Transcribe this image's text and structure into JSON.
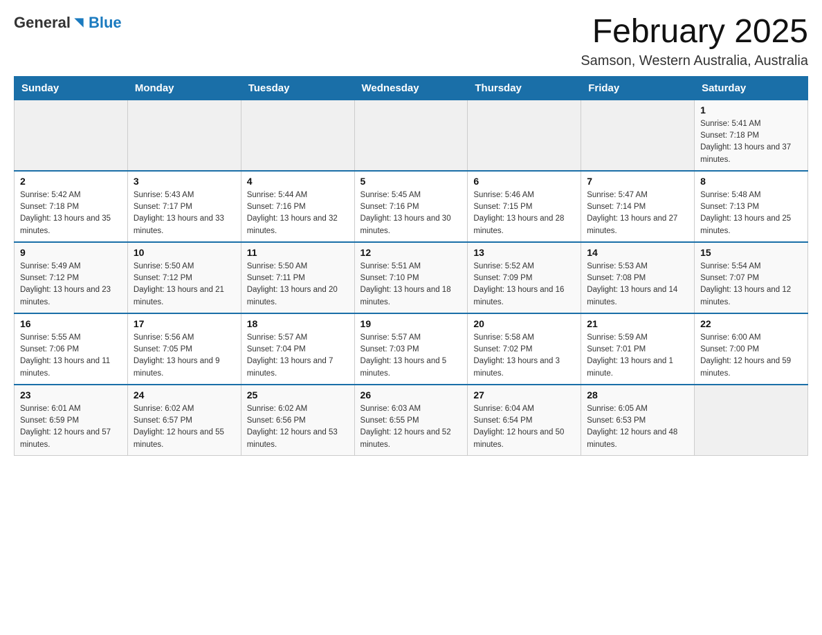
{
  "header": {
    "logo_general": "General",
    "logo_blue": "Blue",
    "month_title": "February 2025",
    "location": "Samson, Western Australia, Australia"
  },
  "days_of_week": [
    "Sunday",
    "Monday",
    "Tuesday",
    "Wednesday",
    "Thursday",
    "Friday",
    "Saturday"
  ],
  "weeks": [
    {
      "days": [
        {
          "number": "",
          "info": "",
          "empty": true
        },
        {
          "number": "",
          "info": "",
          "empty": true
        },
        {
          "number": "",
          "info": "",
          "empty": true
        },
        {
          "number": "",
          "info": "",
          "empty": true
        },
        {
          "number": "",
          "info": "",
          "empty": true
        },
        {
          "number": "",
          "info": "",
          "empty": true
        },
        {
          "number": "1",
          "info": "Sunrise: 5:41 AM\nSunset: 7:18 PM\nDaylight: 13 hours and 37 minutes.",
          "empty": false
        }
      ]
    },
    {
      "days": [
        {
          "number": "2",
          "info": "Sunrise: 5:42 AM\nSunset: 7:18 PM\nDaylight: 13 hours and 35 minutes.",
          "empty": false
        },
        {
          "number": "3",
          "info": "Sunrise: 5:43 AM\nSunset: 7:17 PM\nDaylight: 13 hours and 33 minutes.",
          "empty": false
        },
        {
          "number": "4",
          "info": "Sunrise: 5:44 AM\nSunset: 7:16 PM\nDaylight: 13 hours and 32 minutes.",
          "empty": false
        },
        {
          "number": "5",
          "info": "Sunrise: 5:45 AM\nSunset: 7:16 PM\nDaylight: 13 hours and 30 minutes.",
          "empty": false
        },
        {
          "number": "6",
          "info": "Sunrise: 5:46 AM\nSunset: 7:15 PM\nDaylight: 13 hours and 28 minutes.",
          "empty": false
        },
        {
          "number": "7",
          "info": "Sunrise: 5:47 AM\nSunset: 7:14 PM\nDaylight: 13 hours and 27 minutes.",
          "empty": false
        },
        {
          "number": "8",
          "info": "Sunrise: 5:48 AM\nSunset: 7:13 PM\nDaylight: 13 hours and 25 minutes.",
          "empty": false
        }
      ]
    },
    {
      "days": [
        {
          "number": "9",
          "info": "Sunrise: 5:49 AM\nSunset: 7:12 PM\nDaylight: 13 hours and 23 minutes.",
          "empty": false
        },
        {
          "number": "10",
          "info": "Sunrise: 5:50 AM\nSunset: 7:12 PM\nDaylight: 13 hours and 21 minutes.",
          "empty": false
        },
        {
          "number": "11",
          "info": "Sunrise: 5:50 AM\nSunset: 7:11 PM\nDaylight: 13 hours and 20 minutes.",
          "empty": false
        },
        {
          "number": "12",
          "info": "Sunrise: 5:51 AM\nSunset: 7:10 PM\nDaylight: 13 hours and 18 minutes.",
          "empty": false
        },
        {
          "number": "13",
          "info": "Sunrise: 5:52 AM\nSunset: 7:09 PM\nDaylight: 13 hours and 16 minutes.",
          "empty": false
        },
        {
          "number": "14",
          "info": "Sunrise: 5:53 AM\nSunset: 7:08 PM\nDaylight: 13 hours and 14 minutes.",
          "empty": false
        },
        {
          "number": "15",
          "info": "Sunrise: 5:54 AM\nSunset: 7:07 PM\nDaylight: 13 hours and 12 minutes.",
          "empty": false
        }
      ]
    },
    {
      "days": [
        {
          "number": "16",
          "info": "Sunrise: 5:55 AM\nSunset: 7:06 PM\nDaylight: 13 hours and 11 minutes.",
          "empty": false
        },
        {
          "number": "17",
          "info": "Sunrise: 5:56 AM\nSunset: 7:05 PM\nDaylight: 13 hours and 9 minutes.",
          "empty": false
        },
        {
          "number": "18",
          "info": "Sunrise: 5:57 AM\nSunset: 7:04 PM\nDaylight: 13 hours and 7 minutes.",
          "empty": false
        },
        {
          "number": "19",
          "info": "Sunrise: 5:57 AM\nSunset: 7:03 PM\nDaylight: 13 hours and 5 minutes.",
          "empty": false
        },
        {
          "number": "20",
          "info": "Sunrise: 5:58 AM\nSunset: 7:02 PM\nDaylight: 13 hours and 3 minutes.",
          "empty": false
        },
        {
          "number": "21",
          "info": "Sunrise: 5:59 AM\nSunset: 7:01 PM\nDaylight: 13 hours and 1 minute.",
          "empty": false
        },
        {
          "number": "22",
          "info": "Sunrise: 6:00 AM\nSunset: 7:00 PM\nDaylight: 12 hours and 59 minutes.",
          "empty": false
        }
      ]
    },
    {
      "days": [
        {
          "number": "23",
          "info": "Sunrise: 6:01 AM\nSunset: 6:59 PM\nDaylight: 12 hours and 57 minutes.",
          "empty": false
        },
        {
          "number": "24",
          "info": "Sunrise: 6:02 AM\nSunset: 6:57 PM\nDaylight: 12 hours and 55 minutes.",
          "empty": false
        },
        {
          "number": "25",
          "info": "Sunrise: 6:02 AM\nSunset: 6:56 PM\nDaylight: 12 hours and 53 minutes.",
          "empty": false
        },
        {
          "number": "26",
          "info": "Sunrise: 6:03 AM\nSunset: 6:55 PM\nDaylight: 12 hours and 52 minutes.",
          "empty": false
        },
        {
          "number": "27",
          "info": "Sunrise: 6:04 AM\nSunset: 6:54 PM\nDaylight: 12 hours and 50 minutes.",
          "empty": false
        },
        {
          "number": "28",
          "info": "Sunrise: 6:05 AM\nSunset: 6:53 PM\nDaylight: 12 hours and 48 minutes.",
          "empty": false
        },
        {
          "number": "",
          "info": "",
          "empty": true
        }
      ]
    }
  ]
}
